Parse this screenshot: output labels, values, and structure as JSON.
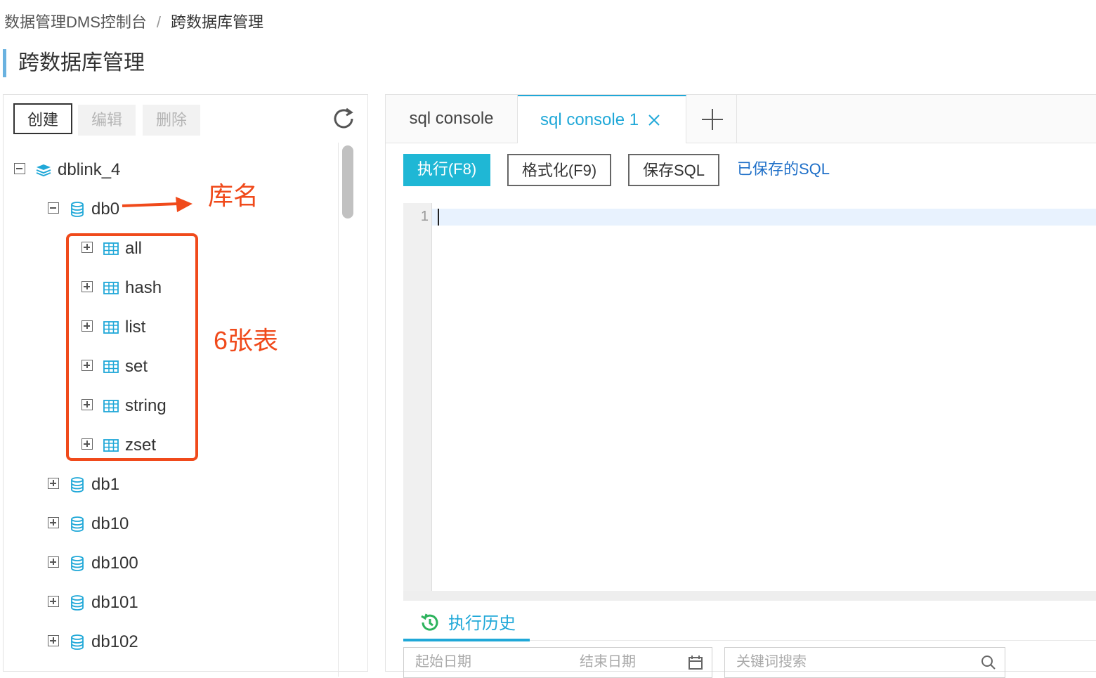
{
  "breadcrumb": {
    "root": "数据管理DMS控制台",
    "separator": "/",
    "current": "跨数据库管理"
  },
  "page_title": "跨数据库管理",
  "toolbar": {
    "create": "创建",
    "edit": "编辑",
    "delete": "删除",
    "refresh_icon": "refresh-icon"
  },
  "tree": {
    "root": {
      "label": "dblink_4",
      "icon": "dblink-icon",
      "expanded": true
    },
    "db0": {
      "label": "db0",
      "icon": "database-icon",
      "expanded": true
    },
    "tables": [
      {
        "label": "all",
        "icon": "table-icon"
      },
      {
        "label": "hash",
        "icon": "table-icon"
      },
      {
        "label": "list",
        "icon": "table-icon"
      },
      {
        "label": "set",
        "icon": "table-icon"
      },
      {
        "label": "string",
        "icon": "table-icon"
      },
      {
        "label": "zset",
        "icon": "table-icon"
      }
    ],
    "databases": [
      {
        "label": "db1"
      },
      {
        "label": "db10"
      },
      {
        "label": "db100"
      },
      {
        "label": "db101"
      },
      {
        "label": "db102"
      }
    ]
  },
  "annotations": {
    "db_name": "库名",
    "tables": "6张表",
    "color": "#f04a1b"
  },
  "tabs": [
    {
      "label": "sql console",
      "active": false
    },
    {
      "label": "sql console 1",
      "active": true,
      "closable": true
    }
  ],
  "editor_toolbar": {
    "run": "执行(F8)",
    "format": "格式化(F9)",
    "save": "保存SQL",
    "saved": "已保存的SQL"
  },
  "editor": {
    "line_numbers": [
      "1"
    ],
    "content": ""
  },
  "history": {
    "tab_label": "执行历史",
    "start_date_placeholder": "起始日期",
    "end_date_placeholder": "结束日期",
    "keyword_placeholder": "关键词搜索"
  },
  "colors": {
    "accent": "#20a8d8",
    "run_button": "#1fb7d5",
    "link": "#1e6fc8",
    "title_bar": "#6ab2e0"
  }
}
